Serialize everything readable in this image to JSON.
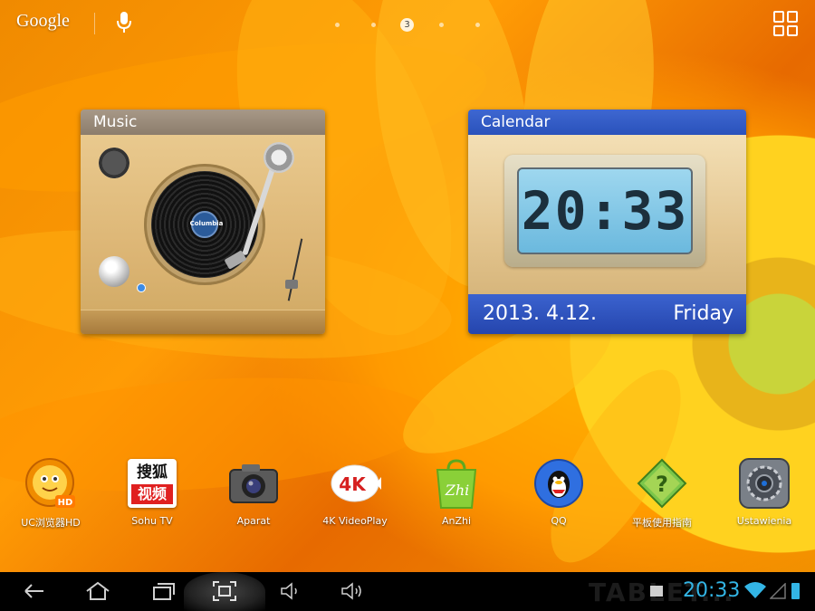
{
  "status_bar": {
    "search_logo": "Google",
    "current_page": "3",
    "colors": {
      "accent": "#33b5e5"
    }
  },
  "widgets": {
    "music": {
      "title": "Music",
      "record_label": "Columbia"
    },
    "calendar": {
      "title": "Calendar",
      "time": "20:33",
      "date": "2013. 4.12.",
      "weekday": "Friday"
    }
  },
  "apps": [
    {
      "label": "UC浏览器HD",
      "icon": "uc-browser-icon"
    },
    {
      "label": "Sohu TV",
      "icon": "sohu-tv-icon",
      "icon_text": "搜狐视频"
    },
    {
      "label": "Aparat",
      "icon": "camera-icon"
    },
    {
      "label": "4K VideoPlay",
      "icon": "4k-video-icon",
      "icon_text": "4K"
    },
    {
      "label": "AnZhi",
      "icon": "anzhi-bag-icon",
      "icon_text": "Zhi"
    },
    {
      "label": "QQ",
      "icon": "qq-penguin-icon"
    },
    {
      "label": "平板使用指南",
      "icon": "guide-question-icon",
      "icon_text": "?"
    },
    {
      "label": "Ustawienia",
      "icon": "settings-gear-icon"
    }
  ],
  "nav_bar": {
    "watermark": "TABLET...",
    "time": "20:33",
    "buttons": [
      "back-icon",
      "home-icon",
      "recent-apps-icon",
      "screenshot-icon",
      "volume-down-icon",
      "volume-up-icon"
    ]
  }
}
